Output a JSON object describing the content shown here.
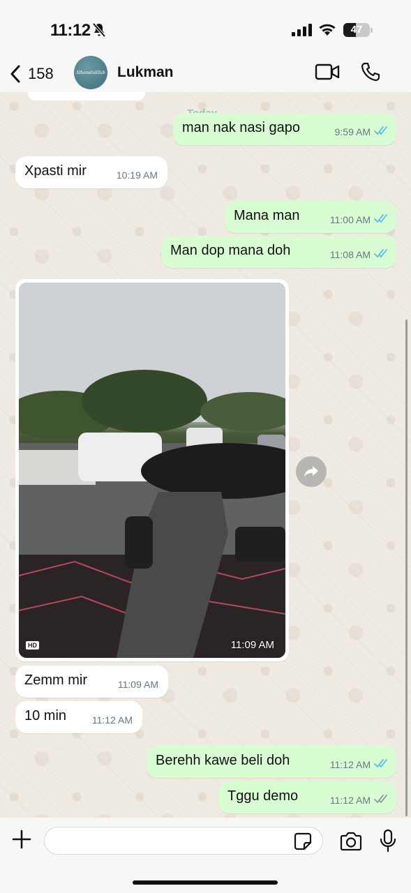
{
  "status_bar": {
    "time": "11:12",
    "battery": "47",
    "battery_level": 0.47
  },
  "header": {
    "back_count": "158",
    "contact_name": "Lukman",
    "avatar_text": "Alhamdulillah"
  },
  "chat": {
    "date_chip": "Today",
    "messages": [
      {
        "text": "man nak nasi gapo",
        "time": "9:59 AM",
        "direction": "out",
        "status": "read"
      },
      {
        "text": "Xpasti mir",
        "time": "10:19 AM",
        "direction": "in"
      },
      {
        "text": "Mana man",
        "time": "11:00 AM",
        "direction": "out",
        "status": "read"
      },
      {
        "text": "Man dop mana doh",
        "time": "11:08 AM",
        "direction": "out",
        "status": "read"
      },
      {
        "text": "Zemm mir",
        "time": "11:09 AM",
        "direction": "in"
      },
      {
        "text": "10 min",
        "time": "11:12 AM",
        "direction": "in"
      },
      {
        "text": "Berehh kawe beli doh",
        "time": "11:12 AM",
        "direction": "out",
        "status": "read"
      },
      {
        "text": "Tggu demo",
        "time": "11:12 AM",
        "direction": "out",
        "status": "delivered"
      }
    ],
    "image": {
      "time": "11:09 AM",
      "badge": "HD",
      "direction": "in"
    }
  },
  "colors": {
    "incoming_bubble": "#ffffff",
    "outgoing_bubble": "#d9fdd3",
    "read_tick": "#53bdeb",
    "delivered_tick": "#8c9699"
  },
  "input": {
    "value": "",
    "placeholder": ""
  }
}
